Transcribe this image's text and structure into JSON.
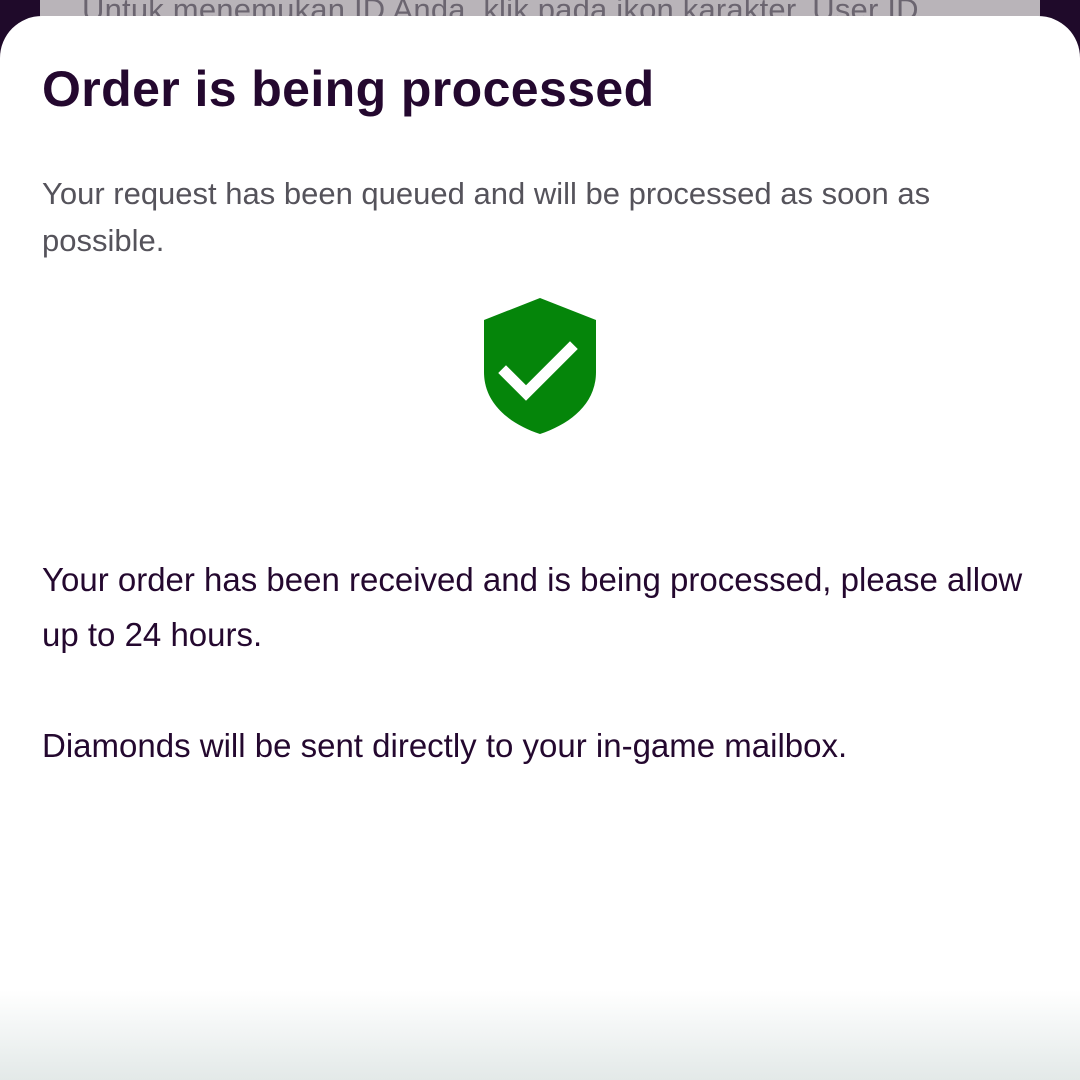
{
  "background": {
    "hint_text": "Untuk menemukan ID Anda, klik pada ikon karakter. User ID"
  },
  "dialog": {
    "title": "Order is being processed",
    "subtitle": "Your request has been queued and will be processed as soon as possible.",
    "status_icon": "shield-check-icon",
    "message_1": "Your order has been received and is being processed, please allow up to 24 hours.",
    "message_2": "Diamonds will be sent directly to your in-game mailbox."
  },
  "colors": {
    "backdrop": "#1f0a2a",
    "title": "#24082f",
    "subtitle": "#55535b",
    "success_green": "#05850a"
  }
}
